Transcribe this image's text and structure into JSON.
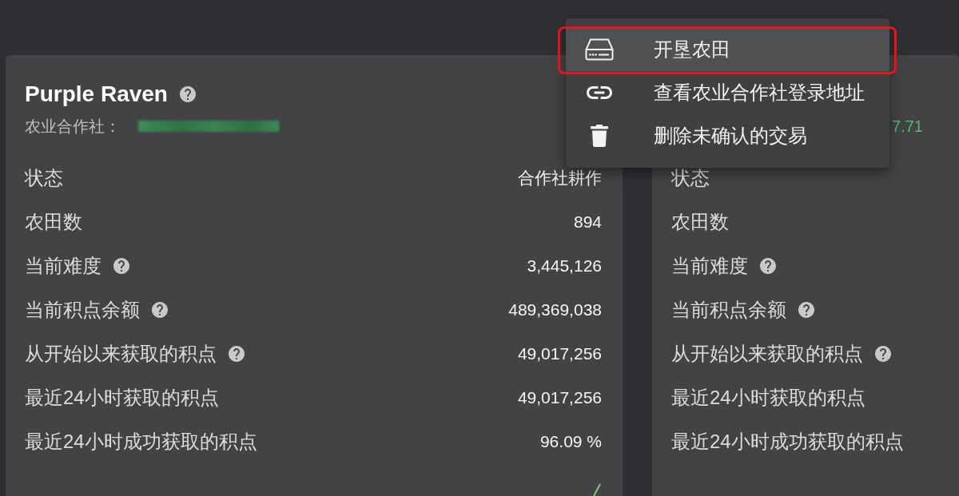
{
  "cards": [
    {
      "title": "Purple Raven",
      "title_help": true,
      "subtitle": "农业合作社：",
      "sparkline": true,
      "rows": [
        {
          "label": "状态",
          "help": false,
          "value": "合作社耕作"
        },
        {
          "label": "农田数",
          "help": false,
          "value": "894"
        },
        {
          "label": "当前难度",
          "help": true,
          "value": "3,445,126"
        },
        {
          "label": "当前积点余额",
          "help": true,
          "value": "489,369,038"
        },
        {
          "label": "从开始以来获取的积点",
          "help": true,
          "value": "49,017,256"
        },
        {
          "label": "最近24小时获取的积点",
          "help": false,
          "value": "49,017,256"
        },
        {
          "label": "最近24小时成功获取的积点",
          "help": false,
          "value": "96.09 %"
        }
      ]
    },
    {
      "balance": "7.71",
      "rows": [
        {
          "label": "状态",
          "help": false
        },
        {
          "label": "农田数",
          "help": false
        },
        {
          "label": "当前难度",
          "help": true
        },
        {
          "label": "当前积点余额",
          "help": true
        },
        {
          "label": "从开始以来获取的积点",
          "help": true
        },
        {
          "label": "最近24小时获取的积点",
          "help": false
        },
        {
          "label": "最近24小时成功获取的积点",
          "help": false
        }
      ]
    }
  ],
  "menu": {
    "items": [
      {
        "kind": "drive",
        "label": "开垦农田",
        "selected": true
      },
      {
        "kind": "link",
        "label": "查看农业合作社登录地址",
        "selected": false
      },
      {
        "kind": "trash",
        "label": "删除未确认的交易",
        "selected": false
      }
    ]
  }
}
